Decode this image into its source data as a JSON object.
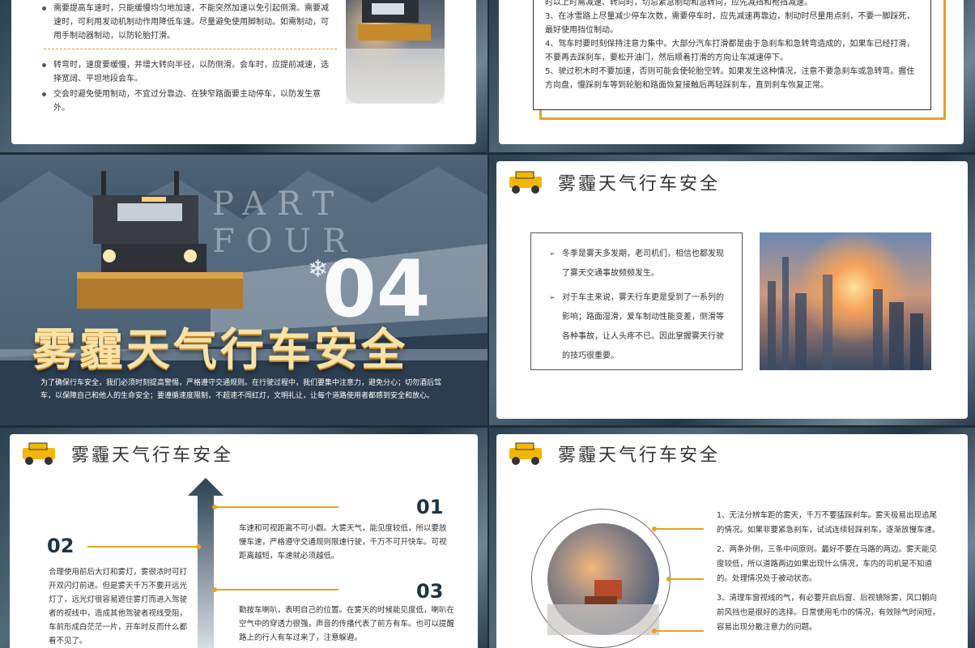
{
  "slide1": {
    "bullets_top": [
      "需要提高车速时，只能缓慢均匀地加速，不能突然加速以免引起侧滑。需要减速时，可利用发动机制动作用降低车速。尽量避免使用脚制动。如需制动，可用手制动器制动，以防轮胎打滑。"
    ],
    "bullets_bottom": [
      "转弯时，速度要缓慢，并增大转向半径，以防侧滑。会车时，应提前减速，选择宽阔、平坦地段会车。",
      "交会时避免使用制动，不宜过分靠边、在狭窄路面要主动停车，以防发生意外。"
    ]
  },
  "slide2": {
    "items": [
      "时以上时需减速、转向时，切忌紧急制动和急转向，应先减挡和枪挡减速。",
      "3、在冰雪路上尽量减少停车次数，需要停车时，应先减速再靠边，制动时尽量用点刹，不要一脚踩死，最好使用挡位制动。",
      "4、驾车时要时刻保持注意力集中。大部分汽车打滑都是由于急刹车和急转弯造成的，如果车已经打滑，不要再去踩刹车，要松开油门，然后顺着打滑的方向让车减速停下。",
      "5、驶过积木时不要加速，否则可能会使轮胎空转。如果发生这种情况，注意不要急刹车或急转弯。握住方向盘，慢踩刹车等到轮胎和路面恢复接触后再轻踩刹车，直到刹车恢复正常。"
    ]
  },
  "slide3": {
    "part": "PART FOUR",
    "number": "04",
    "title": "雾霾天气行车安全",
    "desc": "为了确保行车安全，我们必须时刻提高警惕，严格遵守交通规则。在行驶过程中，我们要集中注意力，避免分心；切勿酒后驾车，以保障自己和他人的生命安全；要遵循速度限制，不超速不闯红灯，文明礼让，让每个道路使用者都感到安全和放心。"
  },
  "slide4": {
    "title": "雾霾天气行车安全",
    "bullets": [
      "冬季是雾天多发期，老司机们，相信也都发现了雾天交通事故频频发生。",
      "对于车主来说，雾天行车更是受到了一系列的影响；路面湿滑，爱车制动性能变差，侧滑等各种事故，让人头疼不已。因此掌握雾天行驶的技巧很重要。"
    ]
  },
  "slide5": {
    "title": "雾霾天气行车安全",
    "n01": "01",
    "t01": "车速和可视距离不可小觑。大雾天气，能见度较低，所以要放慢车速，严格遵守交通规则限速行驶，千万不可开快车。可视距离越短，车速就必须越低。",
    "n02": "02",
    "t02": "合理使用前后大灯和雾灯，雾很浓时可打开双闪灯前进。但是雾天千万不要开远光灯了，远光灯很容易遮住雾灯而进入驾驶者的视线中，造成其他驾驶者视线受阻，车前形成白茫茫一片，开车时反而什么都看不见了。",
    "n03": "03",
    "t03": "勤按车喇叭，表明自己的位置。在雾天的时候能见度低，喇叭在空气中的穿透力很强，声音的传播代表了前方有车。也可以提醒路上的行人有车过来了，注意躲避。"
  },
  "slide6": {
    "title": "雾霾天气行车安全",
    "items": [
      "1、无法分辨车距的雾天，千万不要猛踩刹车。雾天极易出现追尾的情况。如果非要紧急刹车，试试连续轻踩刹车，逐渐放慢车速。",
      "2、两条外侧，三条中间原则。最好不要在马路的两边。雾天能见度较低，所以道路两边如果出现什么情况，车内的司机是不知道的。处理情况处于被动状态。",
      "3、清理车窗视线的气，有必要开启后窗、后视镜除雾，风口朝向前风挡也是很好的选择。日常使用毛巾的情况，有效除气时间短，容易出现分散注意力的问题。"
    ]
  },
  "colors": {
    "accent": "#e8a321",
    "navy": "#1f3344"
  }
}
